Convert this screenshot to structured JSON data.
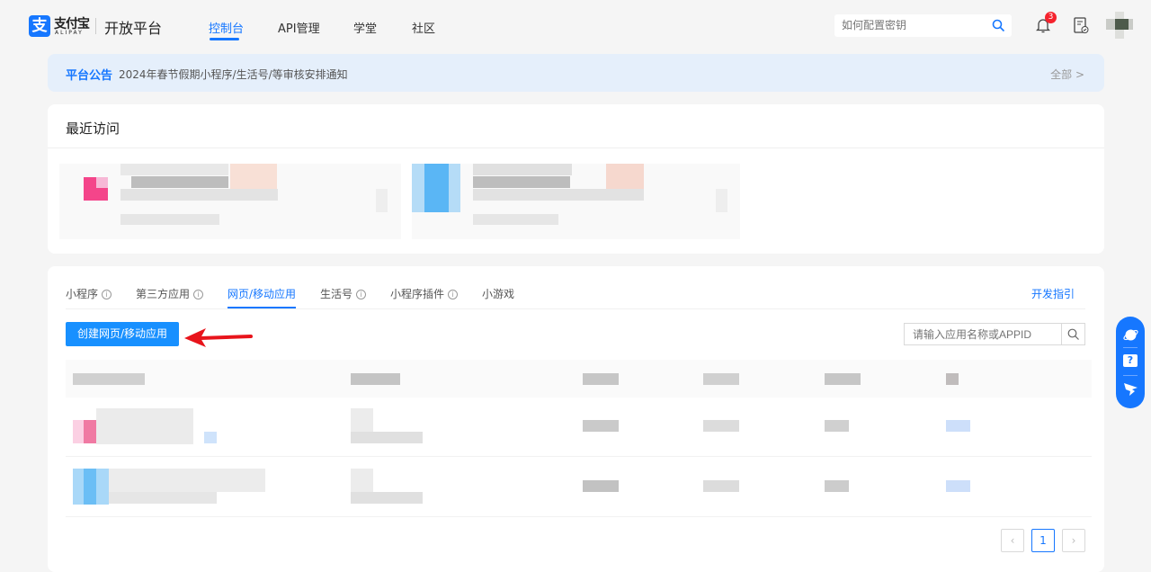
{
  "header": {
    "logo_glyph": "支",
    "logo_cn": "支付宝",
    "logo_en": "ALIPAY",
    "platform": "开放平台",
    "nav": [
      {
        "label": "控制台",
        "active": true
      },
      {
        "label": "API管理"
      },
      {
        "label": "学堂"
      },
      {
        "label": "社区"
      }
    ],
    "search_placeholder": "如何配置密钥",
    "notification_count": "3"
  },
  "notice": {
    "tag": "平台公告",
    "text": "2024年春节假期小程序/生活号/等审核安排通知",
    "all": "全部 >"
  },
  "recent": {
    "title": "最近访问"
  },
  "apps": {
    "tabs": [
      {
        "label": "小程序",
        "info": true
      },
      {
        "label": "第三方应用",
        "info": true
      },
      {
        "label": "网页/移动应用",
        "active": true
      },
      {
        "label": "生活号",
        "info": true
      },
      {
        "label": "小程序插件",
        "info": true
      },
      {
        "label": "小游戏"
      }
    ],
    "dev_guide": "开发指引",
    "create_button": "创建网页/移动应用",
    "search_placeholder": "请输入应用名称或APPID"
  },
  "pagination": {
    "prev": "‹",
    "current": "1",
    "next": "›"
  },
  "colors": {
    "primary": "#1677ff",
    "annotation_arrow": "#e8141b"
  }
}
